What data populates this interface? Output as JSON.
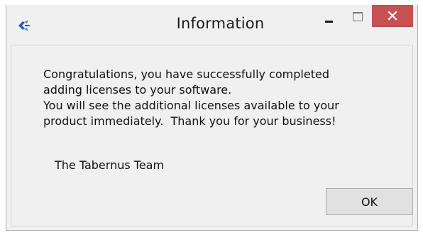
{
  "window": {
    "title": "Information",
    "icon": "tabernus-logo-icon",
    "controls": {
      "minimize_icon": "minimize-icon",
      "maximize_icon": "maximize-icon",
      "close_icon": "close-icon"
    }
  },
  "message": {
    "lines": [
      "Congratulations, you have successfully completed",
      "adding licenses to your software.",
      "You will see the additional licenses available to your",
      "product immediately.  Thank you for your business!"
    ],
    "signature": "The Tabernus Team"
  },
  "buttons": {
    "ok_label": "OK"
  },
  "colors": {
    "close_button": "#c75050",
    "logo_blue": "#1f5fbf",
    "background": "#f0f0f0"
  }
}
